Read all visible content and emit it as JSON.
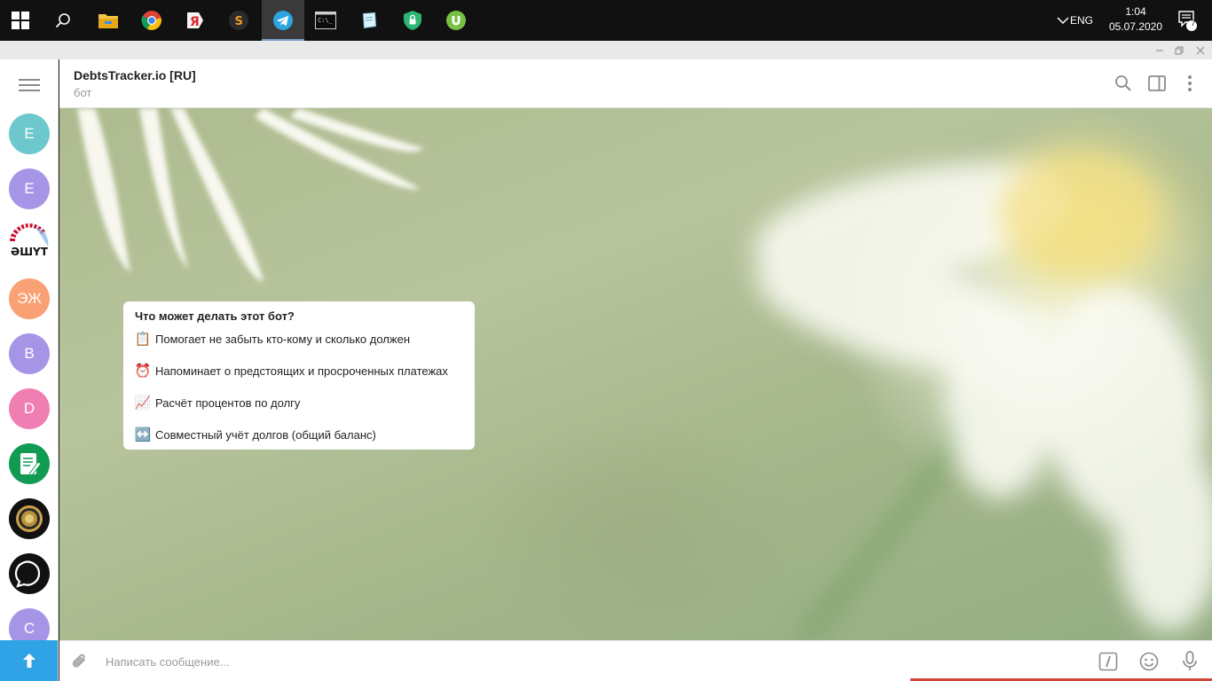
{
  "taskbar": {
    "apps": [
      {
        "name": "file-explorer",
        "active": false
      },
      {
        "name": "chrome",
        "active": false
      },
      {
        "name": "yandex-browser",
        "active": false
      },
      {
        "name": "sublime-text",
        "active": false
      },
      {
        "name": "telegram",
        "active": true
      },
      {
        "name": "command-prompt",
        "active": false
      },
      {
        "name": "notes-app",
        "active": false
      },
      {
        "name": "vpn-app",
        "active": false
      },
      {
        "name": "utorrent",
        "active": false
      }
    ],
    "language": "ENG",
    "time": "1:04",
    "date": "05.07.2020",
    "notification_count": "7"
  },
  "sidebar": {
    "chats": [
      {
        "letter": "E",
        "color": "#6cc8cc"
      },
      {
        "letter": "E",
        "color": "#a695e7"
      },
      {
        "letter": "",
        "kind": "logo-ashut",
        "logo_text": "ӘШҮТ"
      },
      {
        "letter": "ЭЖ",
        "color": "#f9a074"
      },
      {
        "letter": "B",
        "color": "#a695e7"
      },
      {
        "letter": "D",
        "color": "#ef7fb2"
      },
      {
        "letter": "",
        "kind": "logo-notebook",
        "color": "#109a52"
      },
      {
        "letter": "",
        "kind": "logo-seal",
        "color": "#111111"
      },
      {
        "letter": "",
        "kind": "logo-ring",
        "color": "#111111"
      },
      {
        "letter": "C",
        "color": "#a695e7"
      }
    ]
  },
  "chat": {
    "title": "DebtsTracker.io [RU]",
    "subtitle": "бот"
  },
  "bot_info": {
    "title": "Что может делать этот бот?",
    "items": [
      {
        "emoji": "📋",
        "text": "Помогает не забыть кто-кому и сколько должен"
      },
      {
        "emoji": "⏰",
        "text": "Напоминает о предстоящих и просроченных платежах"
      },
      {
        "emoji": "📈",
        "text": "Расчёт процентов по долгу"
      },
      {
        "emoji": "↔️",
        "text": "Совместный учёт долгов (общий баланс)"
      }
    ]
  },
  "compose": {
    "placeholder": "Написать сообщение..."
  },
  "colors": {
    "accent": "#2fa3e6",
    "taskbar": "#111111"
  }
}
